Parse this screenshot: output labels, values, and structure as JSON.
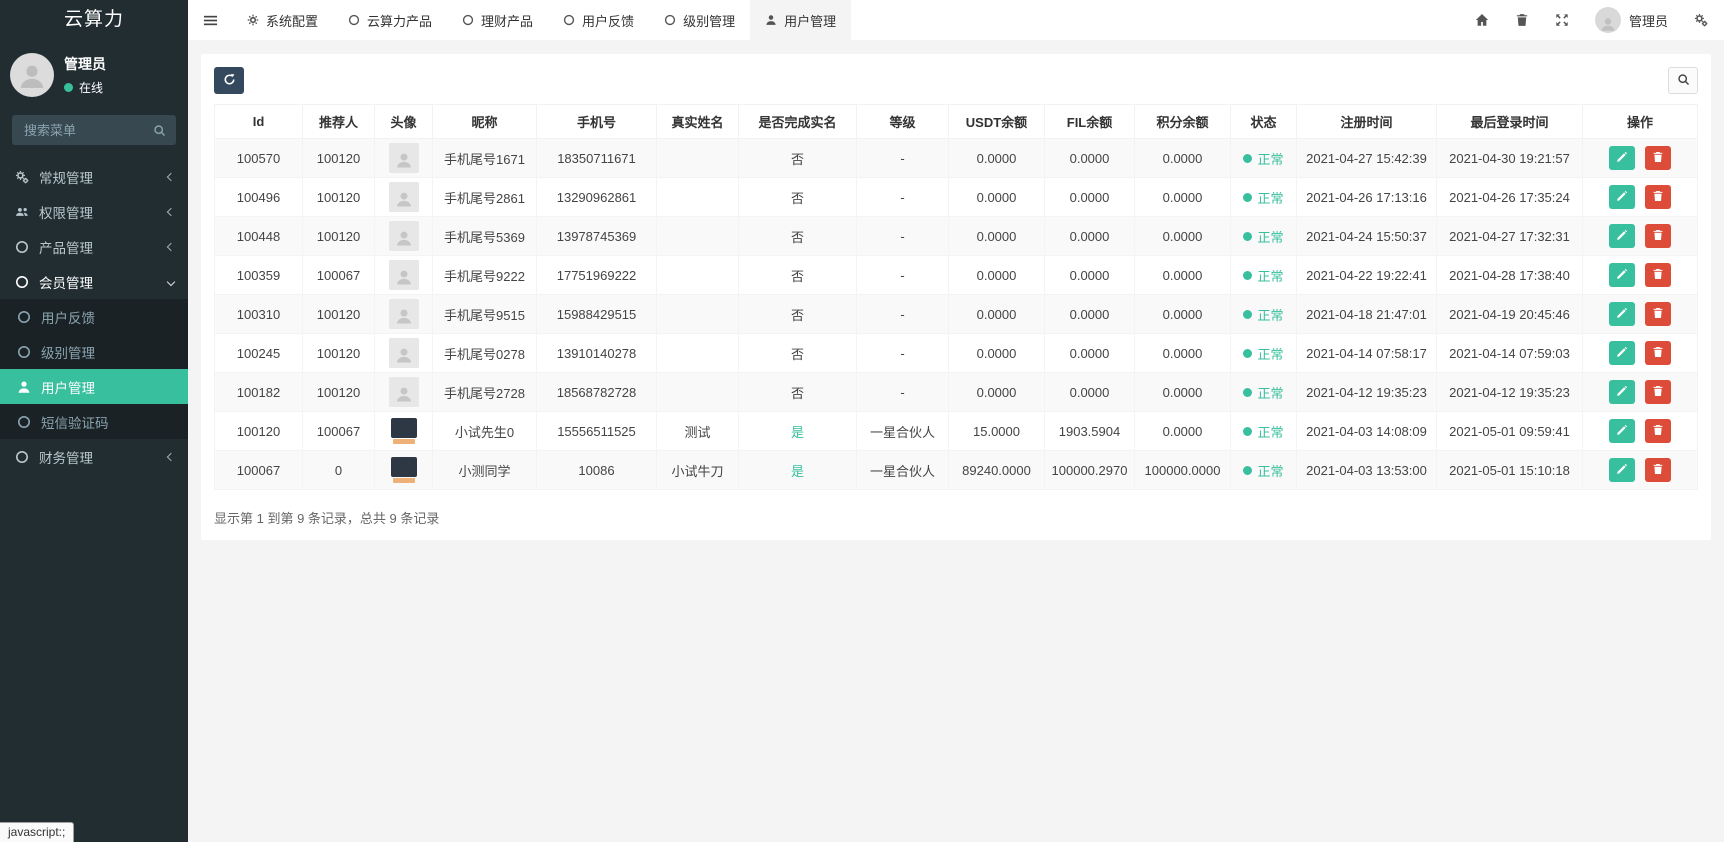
{
  "app": {
    "logo": "云算力"
  },
  "colors": {
    "green": "#38bf9e",
    "red": "#dd4b39",
    "dark_btn": "#35495e",
    "sidebar_bg": "#222d32",
    "submenu_bg": "#1a2226",
    "content_bg": "#f4f4f4"
  },
  "sidebar": {
    "user": {
      "name": "管理员",
      "status": "在线"
    },
    "search_placeholder": "搜索菜单",
    "menu": [
      {
        "id": "general-management",
        "label": "常规管理",
        "icon": "gears",
        "chevron": "left",
        "level": 0
      },
      {
        "id": "permission-management",
        "label": "权限管理",
        "icon": "users",
        "chevron": "left",
        "level": 0
      },
      {
        "id": "product-management",
        "label": "产品管理",
        "icon": "circle",
        "chevron": "left",
        "level": 0
      },
      {
        "id": "member-management",
        "label": "会员管理",
        "icon": "circle",
        "chevron": "down",
        "level": 0,
        "open": true
      },
      {
        "id": "user-feedback",
        "label": "用户反馈",
        "icon": "circle",
        "level": 1
      },
      {
        "id": "level-management",
        "label": "级别管理",
        "icon": "circle",
        "level": 1
      },
      {
        "id": "user-management",
        "label": "用户管理",
        "icon": "user",
        "level": 1,
        "active": true
      },
      {
        "id": "sms-code",
        "label": "短信验证码",
        "icon": "circle",
        "level": 1
      },
      {
        "id": "finance-management",
        "label": "财务管理",
        "icon": "circle",
        "chevron": "left",
        "level": 0
      }
    ]
  },
  "topbar": {
    "tabs": [
      {
        "id": "system-config",
        "label": "系统配置",
        "icon": "gear"
      },
      {
        "id": "cloud-power-products",
        "label": "云算力产品",
        "icon": "circle"
      },
      {
        "id": "wealth-products",
        "label": "理财产品",
        "icon": "circle"
      },
      {
        "id": "user-feedback",
        "label": "用户反馈",
        "icon": "circle"
      },
      {
        "id": "level-management",
        "label": "级别管理",
        "icon": "circle"
      },
      {
        "id": "user-management",
        "label": "用户管理",
        "icon": "user",
        "active": true
      }
    ],
    "user_label": "管理员"
  },
  "table": {
    "columns": [
      "Id",
      "推荐人",
      "头像",
      "昵称",
      "手机号",
      "真实姓名",
      "是否完成实名",
      "等级",
      "USDT余额",
      "FIL余额",
      "积分余额",
      "状态",
      "注册时间",
      "最后登录时间",
      "操作"
    ],
    "rows": [
      {
        "id": "100570",
        "referrer": "100120",
        "avatar": "placeholder",
        "nickname": "手机尾号1671",
        "phone": "18350711671",
        "real_name": "",
        "verified": "否",
        "level": "-",
        "usdt": "0.0000",
        "fil": "0.0000",
        "points": "0.0000",
        "status": "正常",
        "register_time": "2021-04-27 15:42:39",
        "last_login_time": "2021-04-30 19:21:57"
      },
      {
        "id": "100496",
        "referrer": "100120",
        "avatar": "placeholder",
        "nickname": "手机尾号2861",
        "phone": "13290962861",
        "real_name": "",
        "verified": "否",
        "level": "-",
        "usdt": "0.0000",
        "fil": "0.0000",
        "points": "0.0000",
        "status": "正常",
        "register_time": "2021-04-26 17:13:16",
        "last_login_time": "2021-04-26 17:35:24"
      },
      {
        "id": "100448",
        "referrer": "100120",
        "avatar": "placeholder",
        "nickname": "手机尾号5369",
        "phone": "13978745369",
        "real_name": "",
        "verified": "否",
        "level": "-",
        "usdt": "0.0000",
        "fil": "0.0000",
        "points": "0.0000",
        "status": "正常",
        "register_time": "2021-04-24 15:50:37",
        "last_login_time": "2021-04-27 17:32:31"
      },
      {
        "id": "100359",
        "referrer": "100067",
        "avatar": "placeholder",
        "nickname": "手机尾号9222",
        "phone": "17751969222",
        "real_name": "",
        "verified": "否",
        "level": "-",
        "usdt": "0.0000",
        "fil": "0.0000",
        "points": "0.0000",
        "status": "正常",
        "register_time": "2021-04-22 19:22:41",
        "last_login_time": "2021-04-28 17:38:40"
      },
      {
        "id": "100310",
        "referrer": "100120",
        "avatar": "placeholder",
        "nickname": "手机尾号9515",
        "phone": "15988429515",
        "real_name": "",
        "verified": "否",
        "level": "-",
        "usdt": "0.0000",
        "fil": "0.0000",
        "points": "0.0000",
        "status": "正常",
        "register_time": "2021-04-18 21:47:01",
        "last_login_time": "2021-04-19 20:45:46"
      },
      {
        "id": "100245",
        "referrer": "100120",
        "avatar": "placeholder",
        "nickname": "手机尾号0278",
        "phone": "13910140278",
        "real_name": "",
        "verified": "否",
        "level": "-",
        "usdt": "0.0000",
        "fil": "0.0000",
        "points": "0.0000",
        "status": "正常",
        "register_time": "2021-04-14 07:58:17",
        "last_login_time": "2021-04-14 07:59:03"
      },
      {
        "id": "100182",
        "referrer": "100120",
        "avatar": "placeholder",
        "nickname": "手机尾号2728",
        "phone": "18568782728",
        "real_name": "",
        "verified": "否",
        "level": "-",
        "usdt": "0.0000",
        "fil": "0.0000",
        "points": "0.0000",
        "status": "正常",
        "register_time": "2021-04-12 19:35:23",
        "last_login_time": "2021-04-12 19:35:23"
      },
      {
        "id": "100120",
        "referrer": "100067",
        "avatar": "photo",
        "nickname": "小试先生0",
        "phone": "15556511525",
        "real_name": "测试",
        "verified": "是",
        "level": "一星合伙人",
        "usdt": "15.0000",
        "fil": "1903.5904",
        "points": "0.0000",
        "status": "正常",
        "register_time": "2021-04-03 14:08:09",
        "last_login_time": "2021-05-01 09:59:41"
      },
      {
        "id": "100067",
        "referrer": "0",
        "avatar": "photo",
        "nickname": "小测同学",
        "phone": "10086",
        "real_name": "小试牛刀",
        "verified": "是",
        "level": "一星合伙人",
        "usdt": "89240.0000",
        "fil": "100000.2970",
        "points": "100000.0000",
        "status": "正常",
        "register_time": "2021-04-03 13:53:00",
        "last_login_time": "2021-05-01 15:10:18"
      }
    ],
    "footer_text": "显示第 1 到第 9 条记录，总共 9 条记录"
  },
  "statusbar": {
    "text": "javascript:;"
  }
}
